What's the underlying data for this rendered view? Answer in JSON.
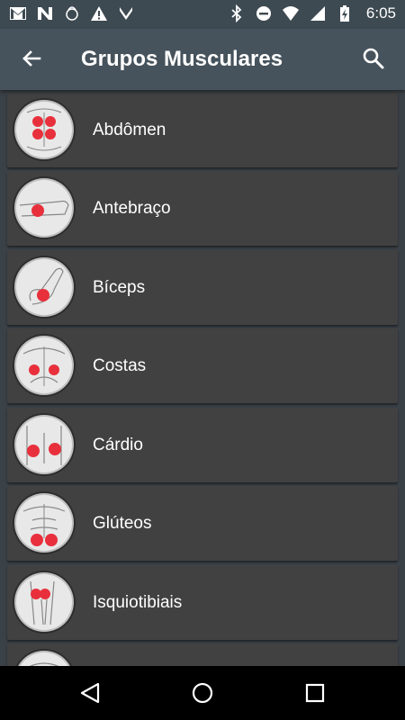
{
  "status_bar": {
    "time": "6:05",
    "left_icons": [
      "gmail-icon",
      "n-logo-icon",
      "kettlebell-icon",
      "warning-icon",
      "v-check-icon"
    ],
    "right_icons": [
      "bluetooth-icon",
      "do-not-disturb-icon",
      "wifi-icon",
      "signal-icon",
      "battery-charging-icon"
    ]
  },
  "app_bar": {
    "title": "Grupos Musculares",
    "back_icon": "arrow-back-icon",
    "search_icon": "search-icon"
  },
  "muscle_groups": [
    {
      "label": "Abdômen",
      "icon": "abdomen-icon"
    },
    {
      "label": "Antebraço",
      "icon": "forearm-icon"
    },
    {
      "label": "Bíceps",
      "icon": "biceps-icon"
    },
    {
      "label": "Costas",
      "icon": "back-muscles-icon"
    },
    {
      "label": "Cárdio",
      "icon": "cardio-icon"
    },
    {
      "label": "Glúteos",
      "icon": "glutes-icon"
    },
    {
      "label": "Isquiotibiais",
      "icon": "hamstrings-icon"
    }
  ],
  "nav_bar": {
    "back": "nav-back-icon",
    "home": "nav-home-icon",
    "recents": "nav-recents-icon"
  },
  "colors": {
    "status_bar": "#3e4a52",
    "app_bar": "#46535c",
    "background": "#3a4147",
    "card": "#414141",
    "highlight": "#e8303c"
  }
}
